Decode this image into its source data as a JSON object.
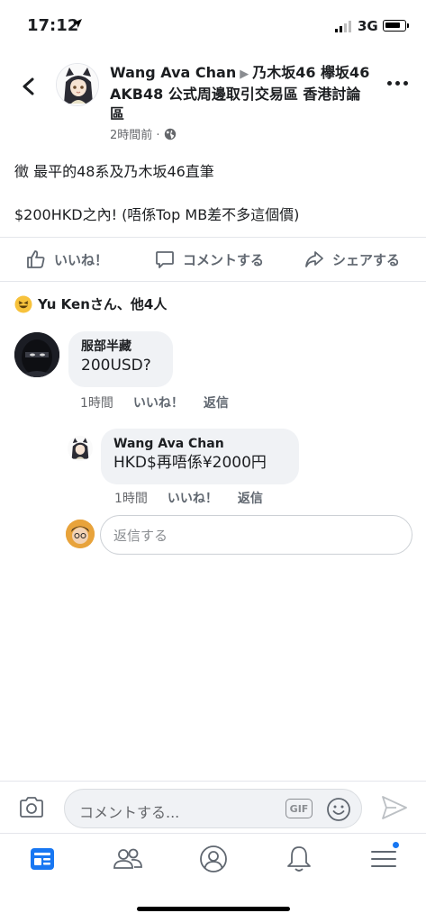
{
  "status_bar": {
    "time": "17:12",
    "network": "3G"
  },
  "post": {
    "author": "Wang Ava Chan",
    "group": "乃木坂46 欅坂46 AKB48 公式周邊取引交易區 香港討論區",
    "time": "2時間前 ·",
    "lines": [
      "徵 最平的48系及乃木坂46直筆",
      "$200HKD之內! (唔係Top MB差不多這個價)"
    ]
  },
  "actions": {
    "like": "いいね！",
    "comment": "コメントする",
    "share": "シェアする"
  },
  "reactions": {
    "text": "Yu Kenさん、他4人"
  },
  "comments": [
    {
      "name": "服部半藏",
      "text": "200USD?",
      "time": "1時間",
      "like": "いいね！",
      "reply": "返信"
    }
  ],
  "replies": [
    {
      "name": "Wang Ava Chan",
      "text": "HKD$再唔係¥2000円",
      "time": "1時間",
      "like": "いいね！",
      "reply": "返信"
    }
  ],
  "reply_input": {
    "placeholder": "返信する"
  },
  "composer": {
    "placeholder": "コメントする...",
    "gif": "GIF"
  },
  "colors": {
    "accent": "#1877f2",
    "bubble": "#f0f2f5",
    "meta": "#65676b"
  }
}
